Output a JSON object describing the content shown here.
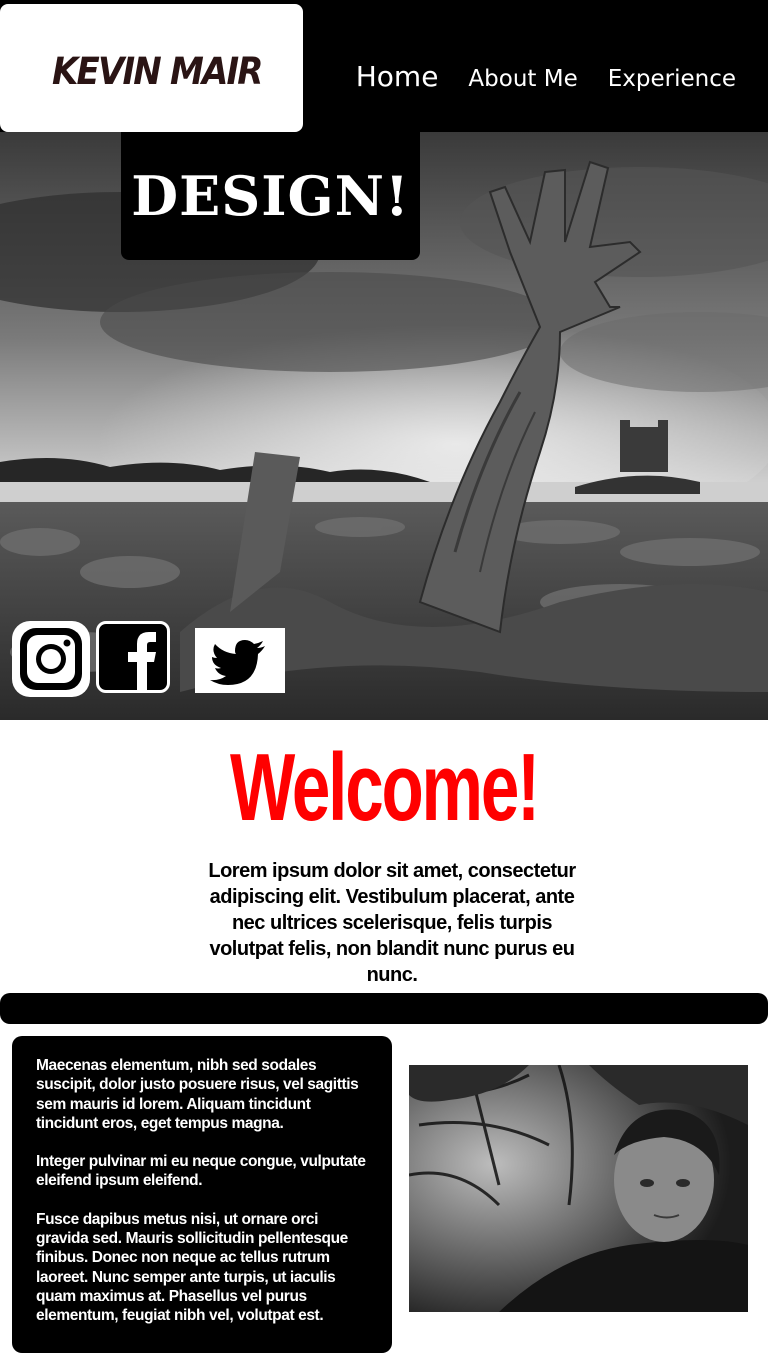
{
  "header": {
    "logo": "KEVIN MAIR",
    "nav": [
      {
        "label": "Home"
      },
      {
        "label": "About Me"
      },
      {
        "label": "Experience"
      }
    ]
  },
  "hero": {
    "banner": "DESIGN!",
    "social": [
      {
        "name": "instagram-icon"
      },
      {
        "name": "facebook-icon"
      },
      {
        "name": "twitter-icon"
      }
    ]
  },
  "welcome": {
    "title": "Welcome!",
    "intro": "Lorem ipsum dolor sit amet, consectetur adipiscing elit. Vestibulum placerat, ante nec ultrices scelerisque, felis turpis volutpat felis, non blandit nunc purus eu nunc."
  },
  "about": {
    "paragraphs": [
      "Maecenas elementum, nibh sed sodales suscipit, dolor justo posuere risus, vel sagittis sem mauris id lorem. Aliquam tincidunt tincidunt eros, eget tempus magna.",
      "Integer pulvinar mi eu neque congue, vulputate eleifend ipsum eleifend.",
      "Fusce dapibus metus nisi, ut ornare orci gravida sed. Mauris sollicitudin pellentesque finibus. Donec non neque ac tellus rutrum laoreet. Nunc semper ante turpis, ut iaculis quam maximus at. Phasellus vel purus elementum, feugiat nibh vel, volutpat est."
    ]
  },
  "colors": {
    "welcome": "#ff0000",
    "header_bg": "#000000"
  }
}
